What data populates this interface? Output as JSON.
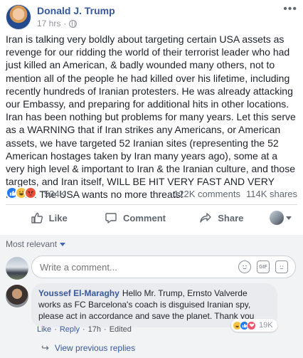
{
  "post": {
    "author": "Donald J. Trump",
    "timestamp": "17 hrs",
    "separator": "·",
    "more": "•••",
    "text": "Iran is talking very boldly about targeting certain USA assets as revenge for our ridding the world of their terrorist leader who had just killed an American, & badly wounded many others, not to mention all of the people he had killed over his lifetime, including recently hundreds of Iranian protesters. He was already attacking our Embassy, and preparing for additional hits in other locations. Iran has been nothing but problems for many years. Let this serve as a WARNING that if Iran strikes any Americans, or American assets, we have targeted 52 Iranian sites (representing the 52 American hostages taken by Iran many years ago), some at a very high level & important to Iran & the Iranian culture, and those targets, and Iran itself, WILL BE HIT VERY FAST AND VERY HARD. The USA wants no more threats!"
  },
  "reactions": {
    "count": "534K",
    "comments": "122K comments",
    "shares": "114K shares",
    "icons": [
      "like-icon",
      "haha-icon",
      "angry-icon"
    ]
  },
  "actions": {
    "like": "Like",
    "comment": "Comment",
    "share": "Share"
  },
  "comments": {
    "sort_label": "Most relevant",
    "input_placeholder": "Write a comment...",
    "input_icons": [
      "emoji-icon",
      "gif-icon",
      "sticker-icon"
    ],
    "items": [
      {
        "name": "Youssef El-Maraghy",
        "text": "Hello Mr. Trump, Ernsto Valverde works as FC Barcelona's coach is disguised Iranian spy, please act in accordance and save the planet. Thank you",
        "like": "Like",
        "dot1": "·",
        "reply": "Reply",
        "dot2": "·",
        "time": "17h",
        "dot3": "·",
        "edited": "Edited",
        "reaction_count": "19K"
      }
    ],
    "view_previous": "View previous replies"
  },
  "colors": {
    "name_blue": "#365899",
    "text": "#1d2129",
    "meta_gray": "#90949c",
    "like_blue": "#2078f4",
    "comment_bg": "#f2f3f5"
  }
}
